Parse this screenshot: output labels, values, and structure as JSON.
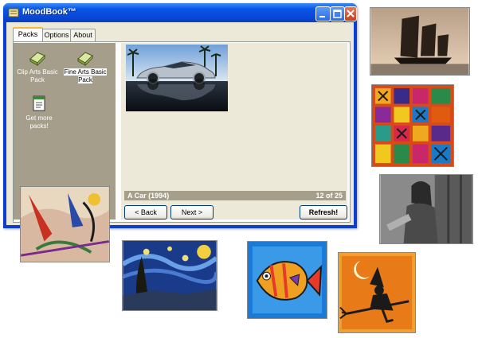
{
  "window": {
    "title": "MoodBook™",
    "buttons": [
      "minimize",
      "maximize",
      "close"
    ]
  },
  "tabs": [
    {
      "label": "Packs",
      "active": true
    },
    {
      "label": "Options",
      "active": false
    },
    {
      "label": "About",
      "active": false
    }
  ],
  "packs": [
    {
      "label": "Clip Arts Basic Pack",
      "icon": "book-icon",
      "selected": false
    },
    {
      "label": "Fine Arts Basic Pack",
      "icon": "book-icon",
      "selected": true
    },
    {
      "label": "Get more packs!",
      "icon": "document-icon",
      "selected": false
    }
  ],
  "viewer": {
    "image": "car-on-reflective-surface",
    "caption": "A Car (1994)",
    "counter": "12 of 25"
  },
  "buttons": {
    "back": "< Back",
    "next": "Next >",
    "refresh": "Refresh!"
  },
  "thumbnails": [
    "junk-sailboat-sunset",
    "african-pattern-textile",
    "woman-photograph",
    "abstract-painting",
    "starry-night",
    "cartoon-fish",
    "witch-on-broom"
  ]
}
